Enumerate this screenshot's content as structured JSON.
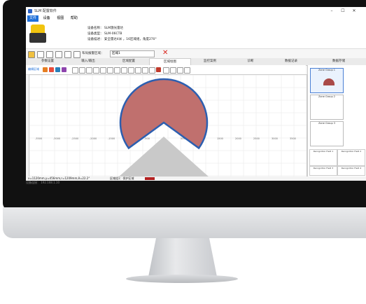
{
  "window": {
    "title": "SLM 配置软件"
  },
  "menu": [
    "文件",
    "设备",
    "视图",
    "帮助"
  ],
  "device": {
    "name": "设备名称： SLM激光雷达",
    "type": "设备类型： SLM-06CTB",
    "desc": "设备描述： 安全雷达4米 ，16区域组，角度270°"
  },
  "toolbar": {
    "layout_label": "布局报警区域：",
    "select_value": "区域1"
  },
  "tabs": [
    "参数设置",
    "输入/输出",
    "区域配置",
    "区域绘图",
    "监控案例",
    "诊断",
    "数据记录",
    "数据存储"
  ],
  "active_tab_index": 3,
  "toolbar2": {
    "label": "编辑区域"
  },
  "plot": {
    "x_ticks": [
      "-3500",
      "-3000",
      "-2500",
      "-2000",
      "-1500",
      "-1000",
      "-500",
      "0",
      "500",
      "1000",
      "1500",
      "2000",
      "2500",
      "3000",
      "3500"
    ],
    "colors": {
      "zone_fill": "#c0706e",
      "zone_stroke": "#2c5fb0",
      "cone": "#c9c9c9"
    }
  },
  "status": {
    "coords": "x=1120mm,y=456mm,r=1209mm,θ=22.2°",
    "area_label": "区域组1：保护区域"
  },
  "zones": [
    "Zone Group 1",
    "Zone Group 2",
    "Zone Group 3"
  ],
  "minis": [
    "Recognition Field 1",
    "Recognition Field 2",
    "Recognition Field 3",
    "Recognition Field 4"
  ],
  "bottom_text": "设备连接： 192.168.1.10"
}
